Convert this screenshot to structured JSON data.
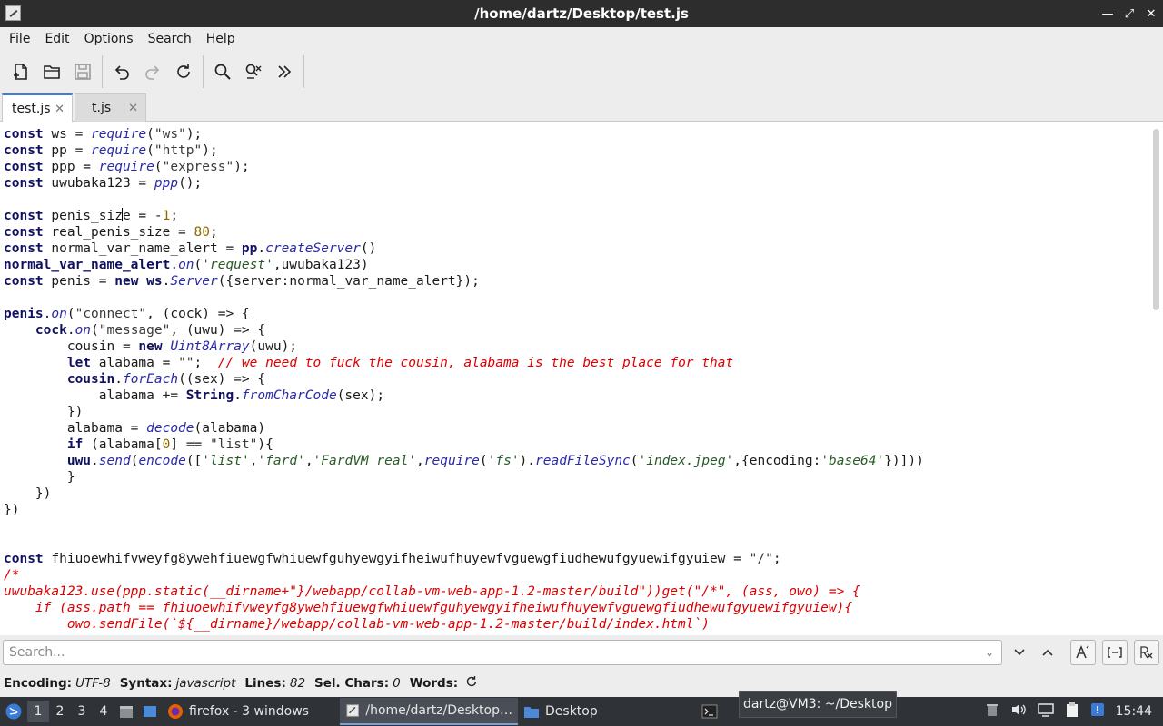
{
  "window": {
    "title": "/home/dartz/Desktop/test.js"
  },
  "menu": [
    "File",
    "Edit",
    "Options",
    "Search",
    "Help"
  ],
  "tabs": [
    {
      "label": "test.js",
      "active": true
    },
    {
      "label": "t.js",
      "active": false
    }
  ],
  "code_lines": [
    "const ws = require(\"ws\");",
    "const pp = require(\"http\");",
    "const ppp = require(\"express\");",
    "const uwubaka123 = ppp();",
    "",
    "const penis_size = -1;",
    "const real_penis_size = 80;",
    "const normal_var_name_alert = pp.createServer()",
    "normal_var_name_alert.on('request',uwubaka123)",
    "const penis = new ws.Server({server:normal_var_name_alert});",
    "",
    "penis.on(\"connect\", (cock) => {",
    "    cock.on(\"message\", (uwu) => {",
    "        cousin = new Uint8Array(uwu);",
    "        let alabama = \"\";  // we need to fuck the cousin, alabama is the best place for that",
    "        cousin.forEach((sex) => {",
    "            alabama += String.fromCharCode(sex);",
    "        })",
    "        alabama = decode(alabama)",
    "        if (alabama[0] == \"list\"){",
    "        uwu.send(encode(['list','fard','FardVM real',require('fs').readFileSync('index.jpeg',{encoding:'base64'})]))",
    "        }",
    "    })",
    "})",
    "",
    "",
    "const fhiuoewhifvweyfg8ywehfiuewgfwhiuewfguhyewgyifheiwufhuyewfvguewgfiudhewufgyuewifgyuiew = \"/\";",
    "/*",
    "uwubaka123.use(ppp.static(__dirname+\"}/webapp/collab-vm-web-app-1.2-master/build\"))get(\"/*\", (ass, owo) => {",
    "    if (ass.path == fhiuoewhifvweyfg8ywehfiuewgfwhiuewfguhyewgyifheiwufhuyewfvguewgfiudhewufgyuewifgyuiew){",
    "        owo.sendFile(`${__dirname}/webapp/collab-vm-web-app-1.2-master/build/index.html`)"
  ],
  "search": {
    "placeholder": "Search...",
    "value": ""
  },
  "status": {
    "encoding_label": "Encoding:",
    "encoding": "UTF-8",
    "syntax_label": "Syntax:",
    "syntax": "javascript",
    "lines_label": "Lines:",
    "lines": "82",
    "sel_label": "Sel. Chars:",
    "sel": "0",
    "words_label": "Words:"
  },
  "taskbar": {
    "workspaces": [
      "1",
      "2",
      "3",
      "4"
    ],
    "tasks": [
      {
        "label": "firefox - 3 windows",
        "icon": "firefox-icon"
      },
      {
        "label": "/home/dartz/Desktop…",
        "icon": "editor-icon",
        "active": true
      },
      {
        "label": "Desktop",
        "icon": "folder-icon"
      }
    ],
    "tooltip": "dartz@VM3: ~/Desktop",
    "clock": "15:44"
  }
}
